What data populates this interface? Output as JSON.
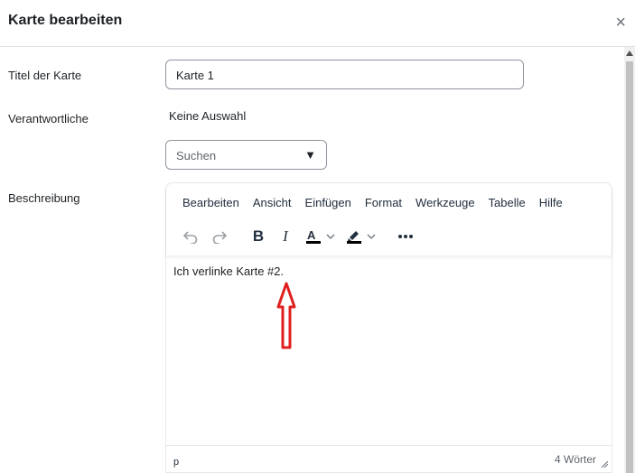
{
  "header": {
    "title": "Karte bearbeiten",
    "close": "×"
  },
  "form": {
    "title_label": "Titel der Karte",
    "title_value": "Karte 1",
    "assignees_label": "Verantwortliche",
    "assignees_value": "Keine Auswahl",
    "search_placeholder": "Suchen",
    "description_label": "Beschreibung"
  },
  "editor": {
    "menu": [
      "Bearbeiten",
      "Ansicht",
      "Einfügen",
      "Format",
      "Werkzeuge",
      "Tabelle",
      "Hilfe"
    ],
    "content": "Ich verlinke Karte #2.",
    "status_path": "p",
    "word_count": "4 Wörter"
  },
  "colors": {
    "annotation_arrow": "#e02020",
    "text_color_underline": "#000000",
    "highlight_color": "#000000"
  }
}
